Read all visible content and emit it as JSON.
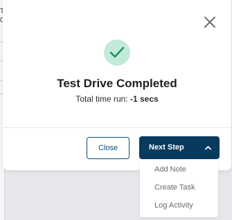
{
  "backdrop": {
    "row1": "T",
    "row2": "0"
  },
  "modal": {
    "title": "Test Drive Completed",
    "time_label": "Total time run:",
    "time_value": "-1 secs",
    "close_button_label": "Close",
    "next_step_label": "Next Step",
    "success_color": "#c2ead8",
    "check_color": "#1e8f5e",
    "primary_color": "#083a5e"
  },
  "dropdown": {
    "items": [
      "Add Note",
      "Create Task",
      "Log Activity"
    ]
  }
}
